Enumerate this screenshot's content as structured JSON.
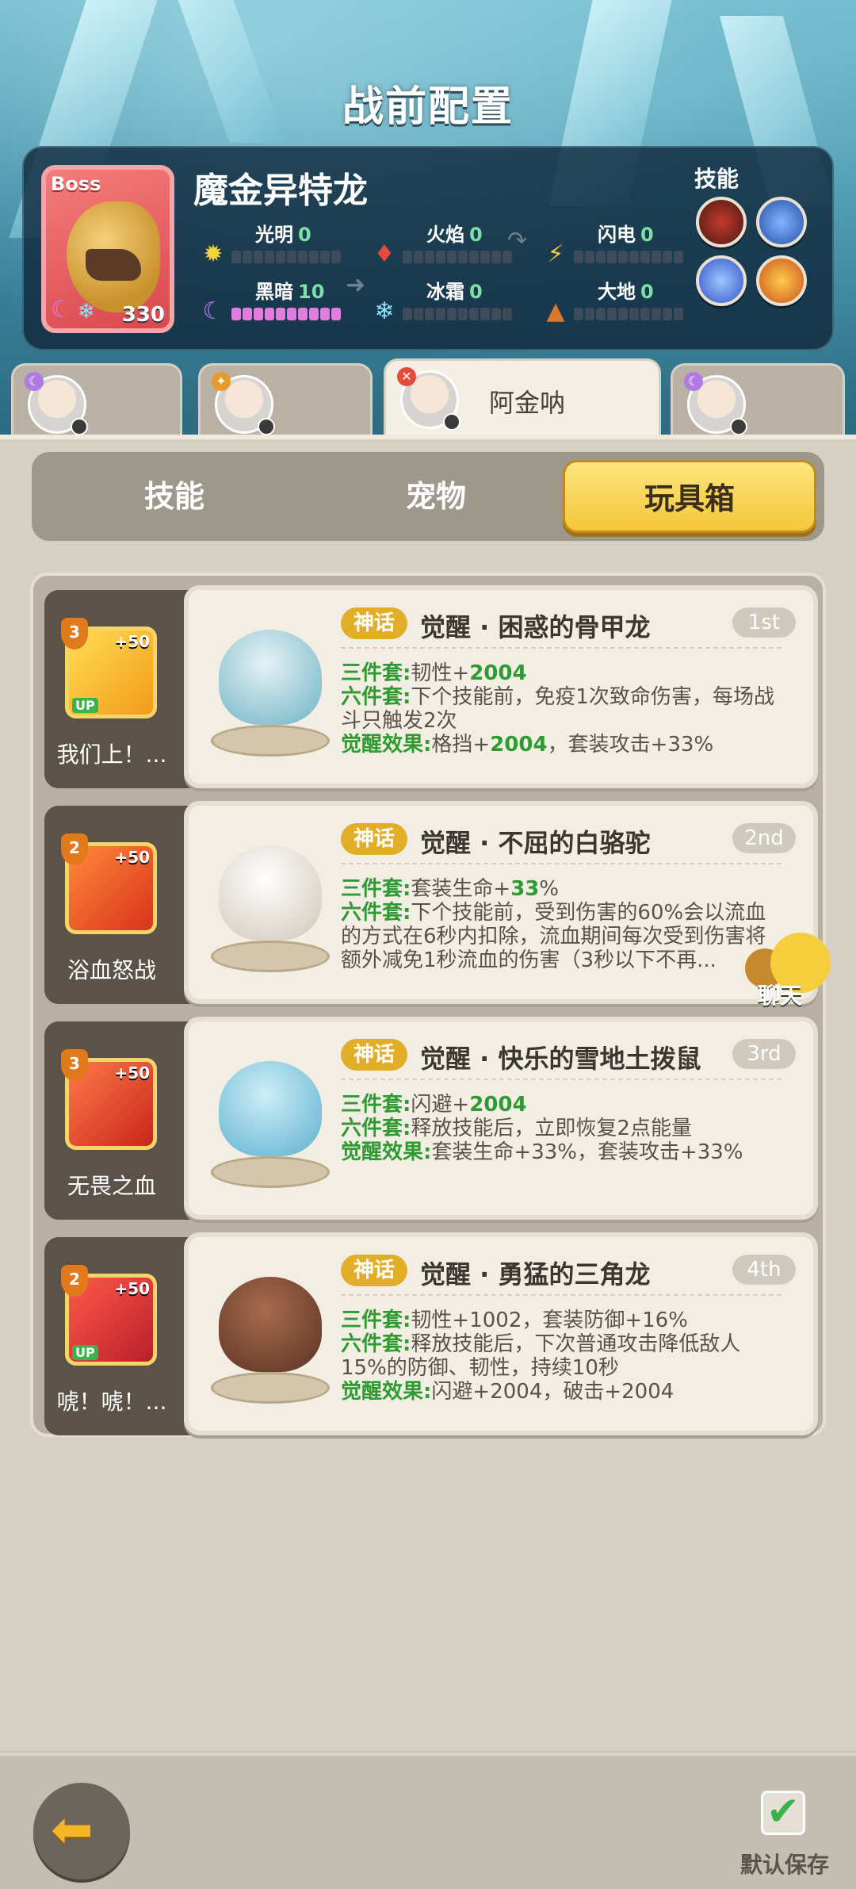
{
  "title": "战前配置",
  "boss": {
    "tag": "Boss",
    "name": "魔金异特龙",
    "level": "330",
    "elements": [
      {
        "name": "光明",
        "value": "0"
      },
      {
        "name": "火焰",
        "value": "0"
      },
      {
        "name": "闪电",
        "value": "0"
      },
      {
        "name": "黑暗",
        "value": "10"
      },
      {
        "name": "冰霜",
        "value": "0"
      },
      {
        "name": "大地",
        "value": "0"
      }
    ],
    "skills_label": "技能",
    "skill_icons": [
      "mouth-skill-icon",
      "lightning-skill-icon",
      "thunder-orb-skill-icon",
      "sun-skill-icon"
    ]
  },
  "characters": [
    {
      "name": ""
    },
    {
      "name": ""
    },
    {
      "name": "阿金呐"
    },
    {
      "name": ""
    }
  ],
  "tabs": [
    "技能",
    "宠物",
    "玩具箱"
  ],
  "active_tab": "玩具箱",
  "items": [
    {
      "toy": {
        "level": "3",
        "plus": "+50",
        "up": "UP",
        "name": "我们上！..."
      },
      "badge": "神话",
      "title": "觉醒 · 困惑的骨甲龙",
      "rank": "1st",
      "lines": [
        {
          "key": "三件套:",
          "text": "韧性+",
          "num": "2004",
          "tail": ""
        },
        {
          "key": "六件套:",
          "text": "下个技能前，免疫1次致命伤害，每场战斗只触发2次",
          "num": "",
          "tail": ""
        },
        {
          "key": "觉醒效果:",
          "text": "格挡+",
          "num": "2004",
          "tail": "，套装攻击+33%"
        }
      ]
    },
    {
      "toy": {
        "level": "2",
        "plus": "+50",
        "up": "",
        "name": "浴血怒战"
      },
      "badge": "神话",
      "title": "觉醒 · 不屈的白骆驼",
      "rank": "2nd",
      "lines": [
        {
          "key": "三件套:",
          "text": "套装生命+",
          "num": "33",
          "tail": "%"
        },
        {
          "key": "六件套:",
          "text": "下个技能前，受到伤害的60%会以流血的方式在6秒内扣除，流血期间每次受到伤害将额外减免1秒流血的伤害（3秒以下不再...",
          "num": "",
          "tail": ""
        }
      ]
    },
    {
      "toy": {
        "level": "3",
        "plus": "+50",
        "up": "",
        "name": "无畏之血"
      },
      "badge": "神话",
      "title": "觉醒 · 快乐的雪地土拨鼠",
      "rank": "3rd",
      "lines": [
        {
          "key": "三件套:",
          "text": "闪避+",
          "num": "2004",
          "tail": ""
        },
        {
          "key": "六件套:",
          "text": "释放技能后，立即恢复2点能量",
          "num": "",
          "tail": ""
        },
        {
          "key": "觉醒效果:",
          "text": "套装生命+33%，套装攻击+33%",
          "num": "",
          "tail": ""
        }
      ]
    },
    {
      "toy": {
        "level": "2",
        "plus": "+50",
        "up": "UP",
        "name": "唬！唬！..."
      },
      "badge": "神话",
      "title": "觉醒 · 勇猛的三角龙",
      "rank": "4th",
      "lines": [
        {
          "key": "三件套:",
          "text": "韧性+1002，套装防御+16%",
          "num": "",
          "tail": ""
        },
        {
          "key": "六件套:",
          "text": "释放技能后，下次普通攻击降低敌人15%的防御、韧性，持续10秒",
          "num": "",
          "tail": ""
        },
        {
          "key": "觉醒效果:",
          "text": "闪避+2004，破击+2004",
          "num": "",
          "tail": ""
        }
      ]
    }
  ],
  "chat_label": "聊天",
  "save_label": "默认保存",
  "colors": {
    "accent": "#f4c63a",
    "mythic": "#e2ae27",
    "green": "#2f9a32"
  }
}
